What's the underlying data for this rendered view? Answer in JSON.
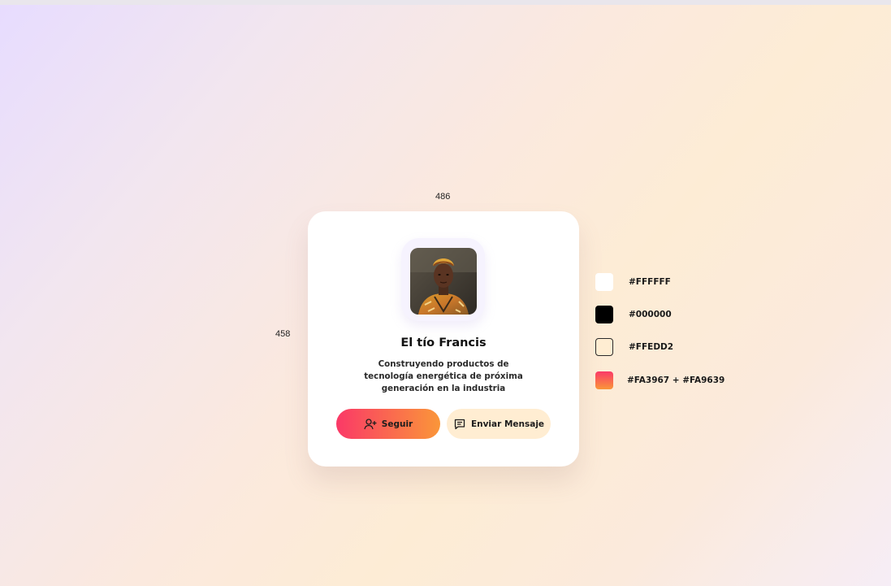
{
  "dimensions": {
    "width_label": "486",
    "height_label": "458"
  },
  "profile": {
    "name": "El tío Francis",
    "bio": "Construyendo productos de tecnología energética de próxima generación en la industria",
    "avatar_icon": "profile-photo"
  },
  "actions": {
    "follow_label": "Seguir",
    "follow_icon": "user-plus-icon",
    "message_label": "Enviar Mensaje",
    "message_icon": "message-icon"
  },
  "palette": [
    {
      "label": "#FFFFFF",
      "color": "#FFFFFF"
    },
    {
      "label": "#000000",
      "color": "#000000"
    },
    {
      "label": "#FFEDD2",
      "color": "#FFEDD2"
    },
    {
      "label": "#FA3967 + #FA9639",
      "color": "#FA3967",
      "color2": "#FA9639"
    }
  ]
}
